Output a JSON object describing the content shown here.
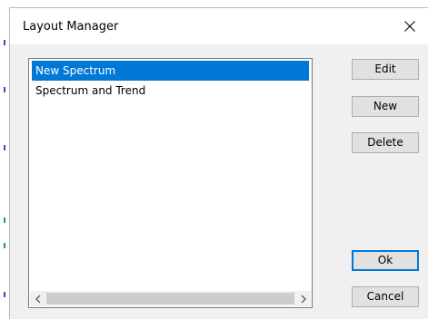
{
  "dialog": {
    "title": "Layout Manager",
    "close_icon": "close-icon"
  },
  "layout_list": {
    "items": [
      {
        "label": "New Spectrum",
        "selected": true
      },
      {
        "label": "Spectrum and Trend",
        "selected": false
      }
    ],
    "scroll_left_icon": "chevron-left-icon",
    "scroll_right_icon": "chevron-right-icon"
  },
  "buttons": {
    "edit_label": "Edit",
    "new_label": "New",
    "delete_label": "Delete",
    "ok_label": "Ok",
    "cancel_label": "Cancel"
  },
  "colors": {
    "selection": "#0078d7",
    "dialog_bg": "#f0f0f0",
    "button_bg": "#e1e1e1"
  }
}
